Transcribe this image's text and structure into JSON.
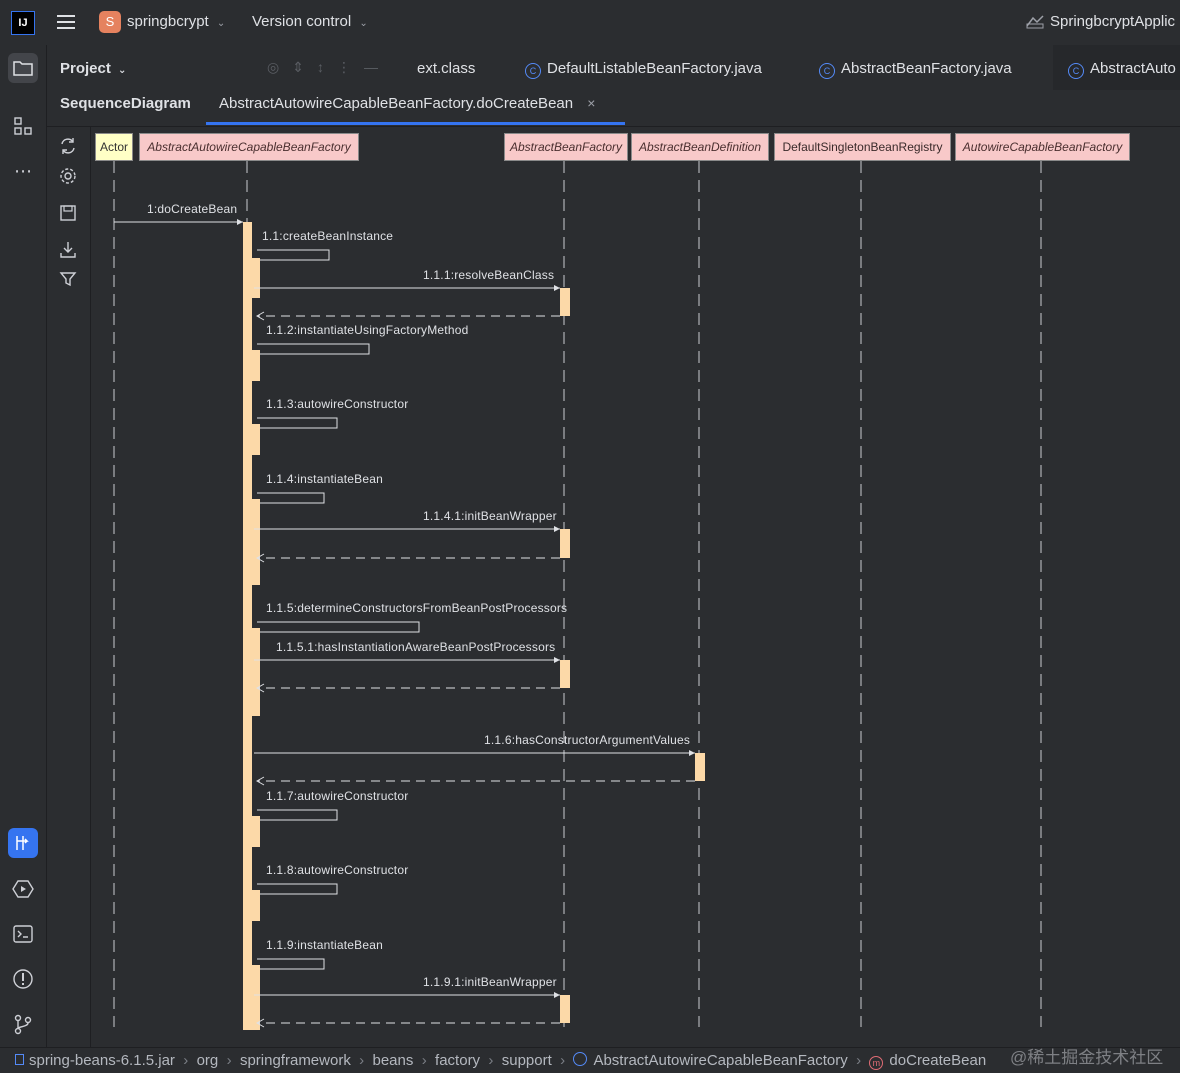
{
  "topbar": {
    "project_initial": "S",
    "project_name": "springbcrypt",
    "vcs_label": "Version control",
    "run_config": "SpringbcryptApplic"
  },
  "tabs": {
    "project_panel": "Project",
    "files": [
      {
        "label": "ext.class"
      },
      {
        "label": "DefaultListableBeanFactory.java"
      },
      {
        "label": "AbstractBeanFactory.java"
      },
      {
        "label": "AbstractAuto"
      }
    ],
    "seq_panel": "SequenceDiagram",
    "seq_tab": "AbstractAutowireCapableBeanFactory.doCreateBean"
  },
  "diagram": {
    "lifelines": [
      {
        "name": "Actor",
        "kind": "actor"
      },
      {
        "name": "AbstractAutowireCapableBeanFactory",
        "kind": "class"
      },
      {
        "name": "AbstractBeanFactory",
        "kind": "class"
      },
      {
        "name": "AbstractBeanDefinition",
        "kind": "class"
      },
      {
        "name": "DefaultSingletonBeanRegistry",
        "kind": "plain"
      },
      {
        "name": "AutowireCapableBeanFactory",
        "kind": "class"
      }
    ],
    "messages": [
      {
        "label": "1:doCreateBean",
        "from": 0,
        "to": 1,
        "type": "call"
      },
      {
        "label": "1.1:createBeanInstance",
        "from": 1,
        "to": 1,
        "type": "self"
      },
      {
        "label": "1.1.1:resolveBeanClass",
        "from": 1,
        "to": 2,
        "type": "call"
      },
      {
        "label": "1.1.2:instantiateUsingFactoryMethod",
        "from": 1,
        "to": 1,
        "type": "self"
      },
      {
        "label": "1.1.3:autowireConstructor",
        "from": 1,
        "to": 1,
        "type": "self"
      },
      {
        "label": "1.1.4:instantiateBean",
        "from": 1,
        "to": 1,
        "type": "self"
      },
      {
        "label": "1.1.4.1:initBeanWrapper",
        "from": 1,
        "to": 2,
        "type": "call"
      },
      {
        "label": "1.1.5:determineConstructorsFromBeanPostProcessors",
        "from": 1,
        "to": 1,
        "type": "self"
      },
      {
        "label": "1.1.5.1:hasInstantiationAwareBeanPostProcessors",
        "from": 1,
        "to": 2,
        "type": "call"
      },
      {
        "label": "1.1.6:hasConstructorArgumentValues",
        "from": 1,
        "to": 3,
        "type": "call"
      },
      {
        "label": "1.1.7:autowireConstructor",
        "from": 1,
        "to": 1,
        "type": "self"
      },
      {
        "label": "1.1.8:autowireConstructor",
        "from": 1,
        "to": 1,
        "type": "self"
      },
      {
        "label": "1.1.9:instantiateBean",
        "from": 1,
        "to": 1,
        "type": "self"
      },
      {
        "label": "1.1.9.1:initBeanWrapper",
        "from": 1,
        "to": 2,
        "type": "call"
      }
    ]
  },
  "breadcrumbs": [
    {
      "label": "spring-beans-6.1.5.jar"
    },
    {
      "label": "org"
    },
    {
      "label": "springframework"
    },
    {
      "label": "beans"
    },
    {
      "label": "factory"
    },
    {
      "label": "support"
    },
    {
      "label": "AbstractAutowireCapableBeanFactory"
    },
    {
      "label": "doCreateBean"
    }
  ],
  "watermark": "@稀土掘金技术社区",
  "colors": {
    "actor_box": "#ffffc6",
    "class_box": "#f8c9c9",
    "activation": "#fcd9a8",
    "accent": "#3574f0"
  }
}
